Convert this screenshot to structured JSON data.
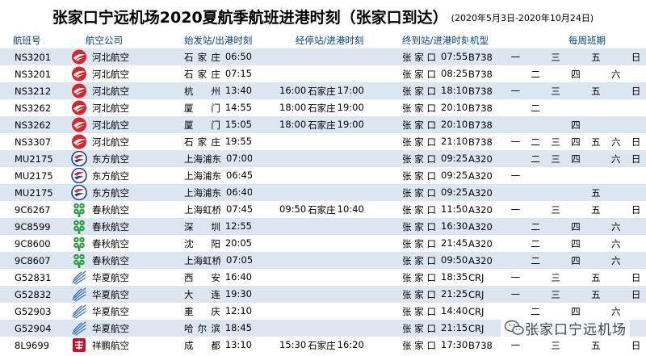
{
  "title": {
    "main": "张家口宁远机场2020夏航季航班进港时刻（张家口到达）",
    "range": "(2020年5月3日-2020年10月24日)"
  },
  "headers": [
    "航班号",
    "航空公司",
    "始发站/出港时刻",
    "经停站/进港时刻",
    "终到站/进港时刻",
    "机型",
    "每周班期"
  ],
  "colors": {
    "hebei": "#d6262e",
    "eastern_red": "#d6262e",
    "eastern_blue": "#1c3f95",
    "spring": "#2f9e48",
    "huaxia": "#3a6fb5",
    "xiangpeng": "#c8102e"
  },
  "rows": [
    {
      "flight": "NS3201",
      "logo": "hebei-airlines-icon",
      "airline": "河北航空",
      "dep_city": "石家庄",
      "dep_time": "06:50",
      "stop_city": "",
      "stop_time": "",
      "dest_city": "张家口",
      "dest_time": "07:55",
      "aircraft": "B738",
      "days": [
        "一",
        "",
        "三",
        "",
        "五",
        "",
        "日"
      ]
    },
    {
      "flight": "NS3201",
      "logo": "hebei-airlines-icon",
      "airline": "河北航空",
      "dep_city": "石家庄",
      "dep_time": "07:15",
      "stop_city": "",
      "stop_time": "",
      "dest_city": "张家口",
      "dest_time": "08:25",
      "aircraft": "B738",
      "days": [
        "",
        "二",
        "",
        "四",
        "",
        "六",
        ""
      ]
    },
    {
      "flight": "NS3212",
      "logo": "hebei-airlines-icon",
      "airline": "河北航空",
      "dep_city": "杭州",
      "dep_time": "13:40",
      "stop_city": "石家庄",
      "stop_time": "16:00|17:00",
      "dest_city": "张家口",
      "dest_time": "18:10",
      "aircraft": "B738",
      "days": [
        "一",
        "",
        "三",
        "",
        "五",
        "",
        "日"
      ]
    },
    {
      "flight": "NS3262",
      "logo": "hebei-airlines-icon",
      "airline": "河北航空",
      "dep_city": "厦门",
      "dep_time": "14:55",
      "stop_city": "石家庄",
      "stop_time": "18:00|19:00",
      "dest_city": "张家口",
      "dest_time": "20:10",
      "aircraft": "B738",
      "days": [
        "",
        "二",
        "",
        "",
        "",
        "",
        ""
      ]
    },
    {
      "flight": "NS3262",
      "logo": "hebei-airlines-icon",
      "airline": "河北航空",
      "dep_city": "厦门",
      "dep_time": "15:05",
      "stop_city": "石家庄",
      "stop_time": "18:00|19:00",
      "dest_city": "张家口",
      "dest_time": "20:10",
      "aircraft": "B738",
      "days": [
        "",
        "",
        "",
        "四",
        "",
        "",
        ""
      ]
    },
    {
      "flight": "NS3307",
      "logo": "hebei-airlines-icon",
      "airline": "河北航空",
      "dep_city": "石家庄",
      "dep_time": "19:55",
      "stop_city": "",
      "stop_time": "",
      "dest_city": "张家口",
      "dest_time": "21:10",
      "aircraft": "B738",
      "days": [
        "一",
        "二",
        "三",
        "四",
        "五",
        "六",
        "日"
      ]
    },
    {
      "flight": "MU2175",
      "logo": "china-eastern-icon",
      "airline": "东方航空",
      "dep_city": "上海浦东",
      "dep_time": "07:00",
      "stop_city": "",
      "stop_time": "",
      "dest_city": "张家口",
      "dest_time": "09:25",
      "aircraft": "A320",
      "days": [
        "",
        "二",
        "三",
        "四",
        "",
        "六",
        "日"
      ]
    },
    {
      "flight": "MU2175",
      "logo": "china-eastern-icon",
      "airline": "东方航空",
      "dep_city": "上海浦东",
      "dep_time": "06:45",
      "stop_city": "",
      "stop_time": "",
      "dest_city": "张家口",
      "dest_time": "09:25",
      "aircraft": "A320",
      "days": [
        "一",
        "",
        "",
        "",
        "",
        "",
        ""
      ]
    },
    {
      "flight": "MU2175",
      "logo": "china-eastern-icon",
      "airline": "东方航空",
      "dep_city": "上海浦东",
      "dep_time": "06:40",
      "stop_city": "",
      "stop_time": "",
      "dest_city": "张家口",
      "dest_time": "09:25",
      "aircraft": "A320",
      "days": [
        "",
        "",
        "",
        "",
        "五",
        "",
        ""
      ]
    },
    {
      "flight": "9C6267",
      "logo": "spring-airlines-icon",
      "airline": "春秋航空",
      "dep_city": "上海虹桥",
      "dep_time": "07:45",
      "stop_city": "石家庄",
      "stop_time": "09:50|10:40",
      "dest_city": "张家口",
      "dest_time": "11:50",
      "aircraft": "A320",
      "days": [
        "一",
        "",
        "三",
        "",
        "五",
        "",
        "日"
      ]
    },
    {
      "flight": "9C8599",
      "logo": "spring-airlines-icon",
      "airline": "春秋航空",
      "dep_city": "深圳",
      "dep_time": "12:55",
      "stop_city": "",
      "stop_time": "",
      "dest_city": "张家口",
      "dest_time": "16:30",
      "aircraft": "A320",
      "days": [
        "",
        "二",
        "",
        "四",
        "",
        "六",
        ""
      ]
    },
    {
      "flight": "9C8600",
      "logo": "spring-airlines-icon",
      "airline": "春秋航空",
      "dep_city": "沈阳",
      "dep_time": "20:05",
      "stop_city": "",
      "stop_time": "",
      "dest_city": "张家口",
      "dest_time": "21:45",
      "aircraft": "A320",
      "days": [
        "",
        "二",
        "",
        "四",
        "",
        "六",
        ""
      ]
    },
    {
      "flight": "9C8607",
      "logo": "spring-airlines-icon",
      "airline": "春秋航空",
      "dep_city": "上海虹桥",
      "dep_time": "07:05",
      "stop_city": "",
      "stop_time": "",
      "dest_city": "张家口",
      "dest_time": "09:50",
      "aircraft": "A320",
      "days": [
        "",
        "二",
        "",
        "四",
        "",
        "六",
        ""
      ]
    },
    {
      "flight": "G52831",
      "logo": "huaxia-airlines-icon",
      "airline": "华夏航空",
      "dep_city": "西安",
      "dep_time": "16:40",
      "stop_city": "",
      "stop_time": "",
      "dest_city": "张家口",
      "dest_time": "18:35",
      "aircraft": "CRJ",
      "days": [
        "一",
        "",
        "三",
        "",
        "五",
        "",
        "日"
      ]
    },
    {
      "flight": "G52832",
      "logo": "huaxia-airlines-icon",
      "airline": "华夏航空",
      "dep_city": "大连",
      "dep_time": "19:30",
      "stop_city": "",
      "stop_time": "",
      "dest_city": "张家口",
      "dest_time": "21:25",
      "aircraft": "CRJ",
      "days": [
        "一",
        "",
        "三",
        "",
        "五",
        "",
        "日"
      ]
    },
    {
      "flight": "G52903",
      "logo": "huaxia-airlines-icon",
      "airline": "华夏航空",
      "dep_city": "重庆",
      "dep_time": "12:10",
      "stop_city": "",
      "stop_time": "",
      "dest_city": "张家口",
      "dest_time": "14:40",
      "aircraft": "CRJ",
      "days": [
        "",
        "二",
        "",
        "四",
        "",
        "六",
        ""
      ]
    },
    {
      "flight": "G52904",
      "logo": "huaxia-airlines-icon",
      "airline": "华夏航空",
      "dep_city": "哈尔滨",
      "dep_time": "18:45",
      "stop_city": "",
      "stop_time": "",
      "dest_city": "张家口",
      "dest_time": "21:15",
      "aircraft": "CRJ",
      "days": [
        "",
        "二",
        "",
        "",
        "",
        "",
        ""
      ]
    },
    {
      "flight": "8L9699",
      "logo": "lucky-air-icon",
      "airline": "祥鹏航空",
      "dep_city": "成都",
      "dep_time": "13:10",
      "stop_city": "石家庄",
      "stop_time": "15:30|16:20",
      "dest_city": "张家口",
      "dest_time": "17:30",
      "aircraft": "B738",
      "days": [
        "一",
        "",
        "三",
        "",
        "五",
        "",
        "日"
      ]
    }
  ],
  "watermark": {
    "icon": "wechat-icon",
    "text": "张家口宁远机场"
  }
}
